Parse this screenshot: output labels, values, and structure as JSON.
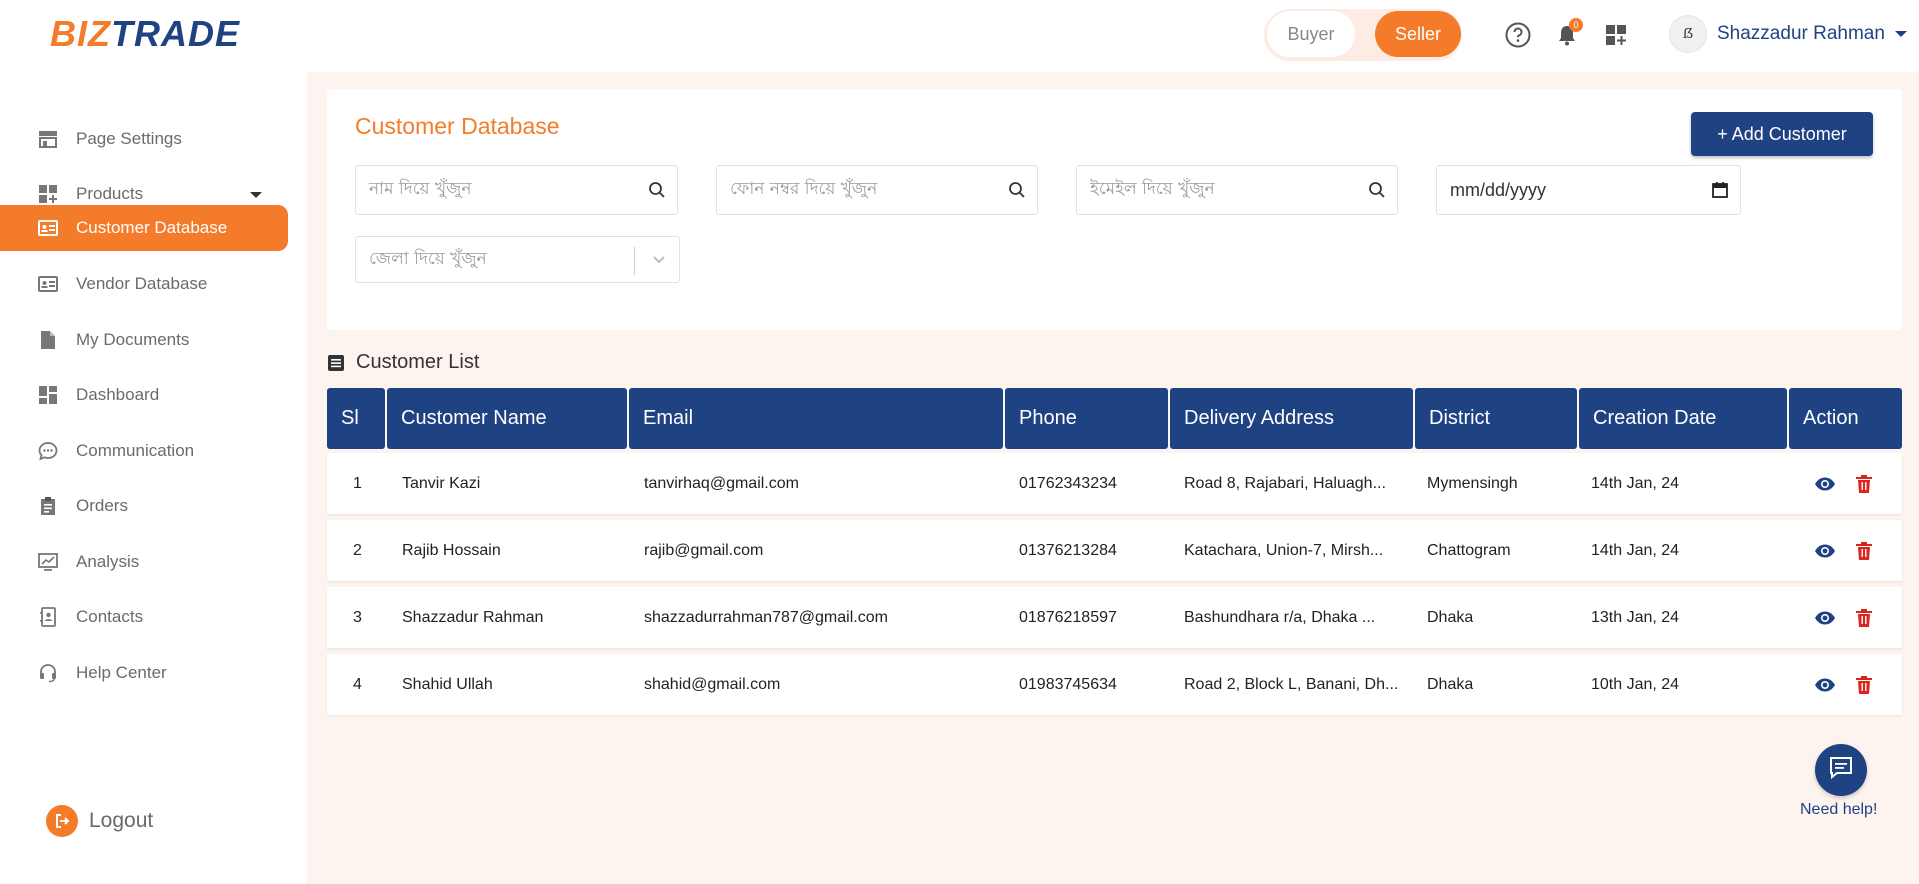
{
  "brand": {
    "part1": "BIZ",
    "part2": "TRADE"
  },
  "header": {
    "role_buyer": "Buyer",
    "role_seller": "Seller",
    "notification_count": "0",
    "user_name": "Shazzadur Rahman",
    "avatar_text": "ẞ"
  },
  "sidebar": {
    "items": [
      {
        "label": "Page Settings"
      },
      {
        "label": "Products"
      },
      {
        "label": "Customer Database"
      },
      {
        "label": "Vendor Database"
      },
      {
        "label": "My Documents"
      },
      {
        "label": "Dashboard"
      },
      {
        "label": "Communication"
      },
      {
        "label": "Orders"
      },
      {
        "label": "Analysis"
      },
      {
        "label": "Contacts"
      },
      {
        "label": "Help Center"
      }
    ],
    "logout": "Logout"
  },
  "filters": {
    "title": "Customer Database",
    "add_button": "+ Add Customer",
    "name_placeholder": "নাম দিয়ে খুঁজুন",
    "phone_placeholder": "ফোন নম্বর দিয়ে খুঁজুন",
    "email_placeholder": "ইমেইল দিয়ে খুঁজুন",
    "date_placeholder": "mm/dd/yyyy",
    "district_placeholder": "জেলা দিয়ে খুঁজুন"
  },
  "list": {
    "title": "Customer List",
    "columns": [
      "Sl",
      "Customer Name",
      "Email",
      "Phone",
      "Delivery Address",
      "District",
      "Creation Date",
      "Action"
    ],
    "rows": [
      {
        "sl": "1",
        "name": "Tanvir Kazi",
        "email": "tanvirhaq@gmail.com",
        "phone": "01762343234",
        "address": "Road 8, Rajabari, Haluagh...",
        "district": "Mymensingh",
        "date": "14th Jan, 24"
      },
      {
        "sl": "2",
        "name": "Rajib Hossain",
        "email": "rajib@gmail.com",
        "phone": "01376213284",
        "address": "Katachara, Union-7, Mirsh...",
        "district": "Chattogram",
        "date": "14th Jan, 24"
      },
      {
        "sl": "3",
        "name": "Shazzadur Rahman",
        "email": "shazzadurrahman787@gmail.com",
        "phone": "01876218597",
        "address": "Bashundhara r/a, Dhaka ...",
        "district": "Dhaka",
        "date": "13th Jan, 24"
      },
      {
        "sl": "4",
        "name": "Shahid Ullah",
        "email": "shahid@gmail.com",
        "phone": "01983745634",
        "address": "Road 2, Block L, Banani, Dh...",
        "district": "Dhaka",
        "date": "10th Jan, 24"
      }
    ]
  },
  "help": {
    "label": "Need help!"
  },
  "colors": {
    "accent": "#f47b2a",
    "primary": "#1f4282",
    "background": "#fdf3ef",
    "danger": "#d9261c"
  }
}
